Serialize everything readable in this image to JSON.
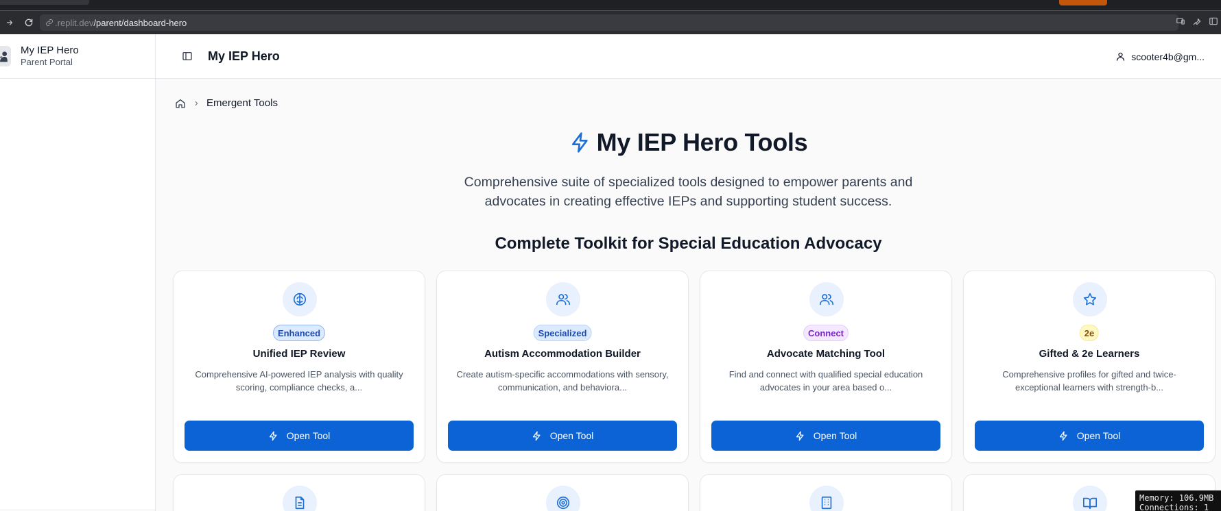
{
  "browser": {
    "url_prefix": ".replit.dev",
    "url_path": "/parent/dashboard-hero"
  },
  "sidebar": {
    "brand_title": "My IEP Hero",
    "brand_subtitle": "Parent Portal"
  },
  "header": {
    "title": "My IEP Hero",
    "user_email": "scooter4b@gm..."
  },
  "breadcrumb": {
    "current": "Emergent Tools"
  },
  "hero": {
    "title": "My IEP Hero Tools",
    "description_line1": "Comprehensive suite of specialized tools designed to empower parents and",
    "description_line2": "advocates in creating effective IEPs and supporting student success."
  },
  "section": {
    "title": "Complete Toolkit for Special Education Advocacy"
  },
  "cards": [
    {
      "icon": "brain-icon",
      "badge": "Enhanced",
      "title": "Unified IEP Review",
      "description": "Comprehensive AI-powered IEP analysis with quality scoring, compliance checks, a...",
      "button": "Open Tool"
    },
    {
      "icon": "users-icon",
      "badge": "Specialized",
      "title": "Autism Accommodation Builder",
      "description": "Create autism-specific accommodations with sensory, communication, and behaviora...",
      "button": "Open Tool"
    },
    {
      "icon": "users-icon",
      "badge": "Connect",
      "title": "Advocate Matching Tool",
      "description": "Find and connect with qualified special education advocates in your area based o...",
      "button": "Open Tool"
    },
    {
      "icon": "star-icon",
      "badge": "2e",
      "title": "Gifted & 2e Learners",
      "description": "Comprehensive profiles for gifted and twice-exceptional learners with strength-b...",
      "button": "Open Tool"
    }
  ],
  "cards_row2_icons": [
    "file-text-icon",
    "target-icon",
    "building-icon",
    "book-open-icon"
  ],
  "debug": {
    "memory": "Memory: 106.9MB",
    "connections": "Connections: 1"
  },
  "colors": {
    "primary": "#0b63d6",
    "accent_icon": "#1d6fd8"
  }
}
